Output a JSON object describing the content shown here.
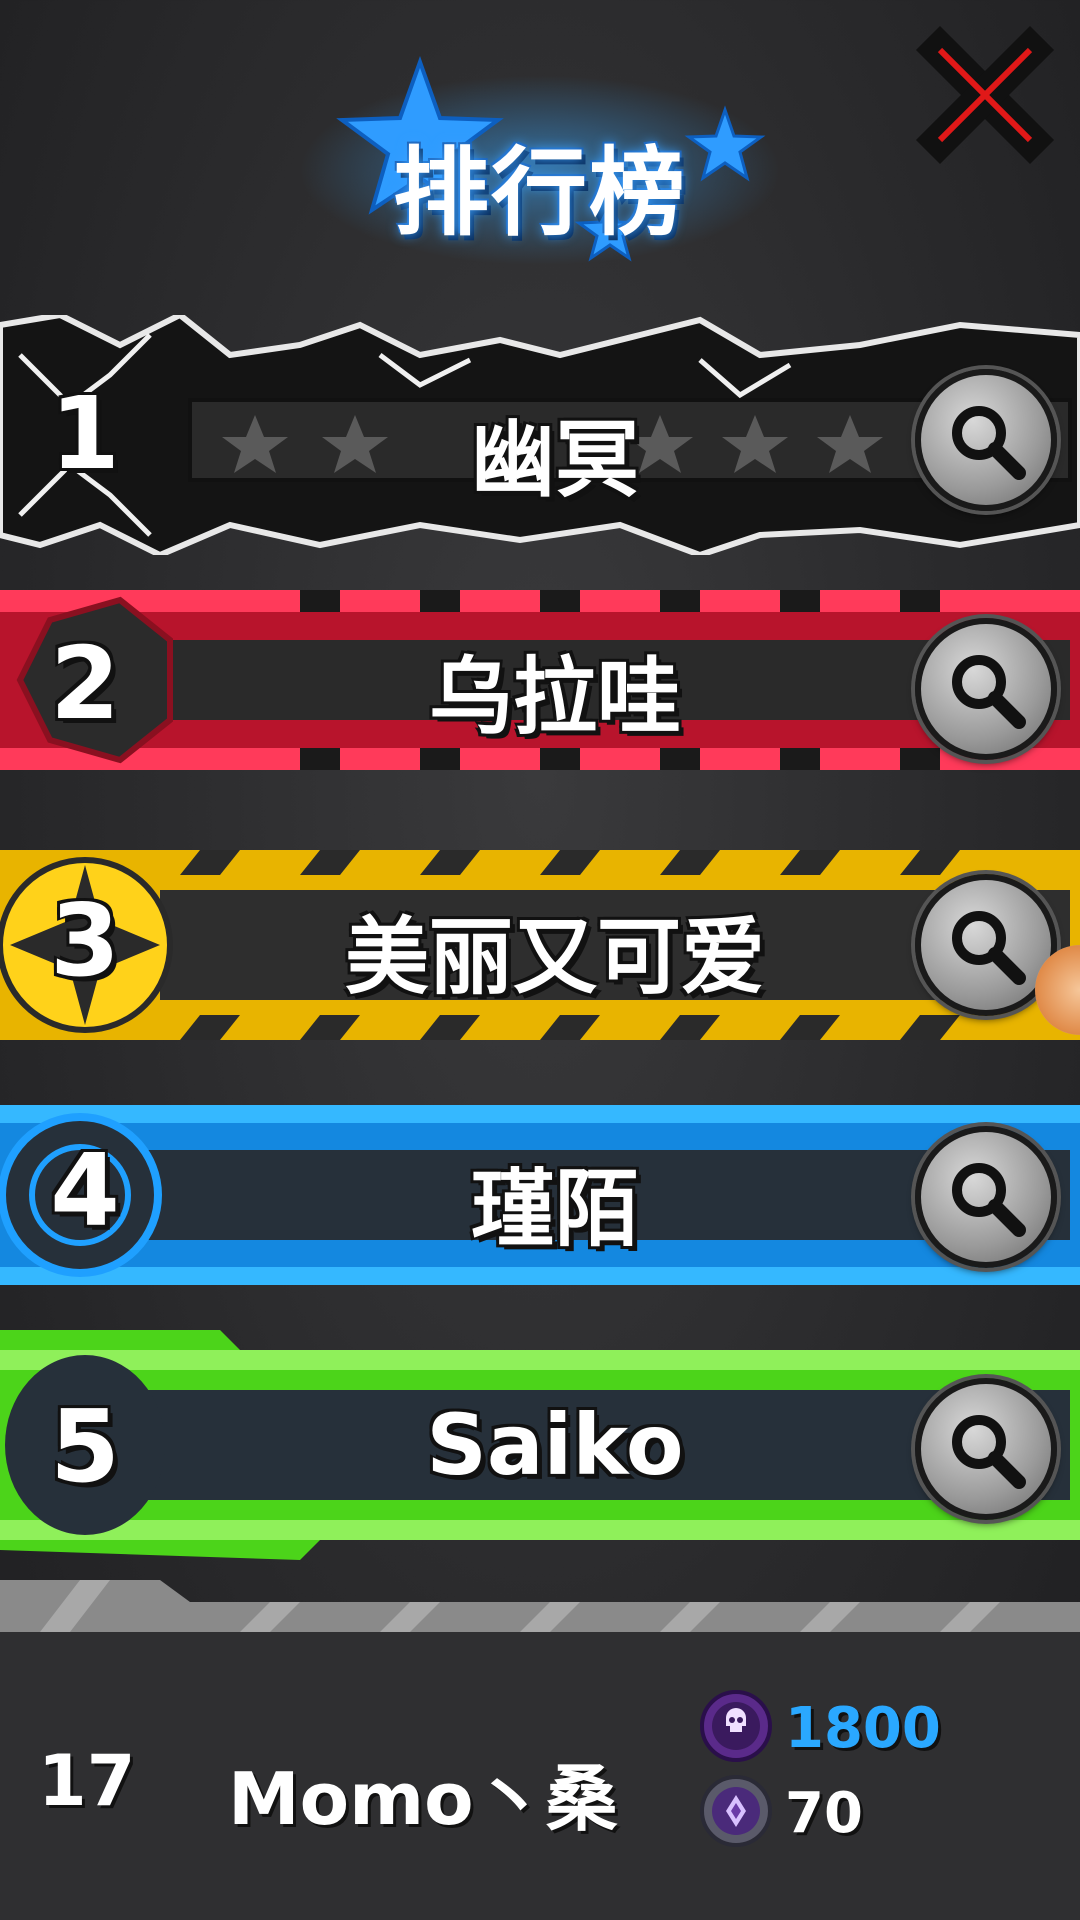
{
  "title": "排行榜",
  "close_icon": "close-x-icon",
  "search_icon": "magnifier-icon",
  "rankings": [
    {
      "rank": "1",
      "name": "幽冥",
      "theme": "#ffffff"
    },
    {
      "rank": "2",
      "name": "乌拉哇",
      "theme": "#e8264a"
    },
    {
      "rank": "3",
      "name": "美丽又可爱",
      "theme": "#ffd21a"
    },
    {
      "rank": "4",
      "name": "瑾陌",
      "theme": "#1aa8ff"
    },
    {
      "rank": "5",
      "name": "Saiko",
      "theme": "#6ff03a"
    }
  ],
  "me": {
    "rank": "17",
    "name": "Momo丶桑",
    "score": "1800",
    "score_color": "#2aa8ff",
    "gems": "70",
    "gems_color": "#ffffff"
  }
}
